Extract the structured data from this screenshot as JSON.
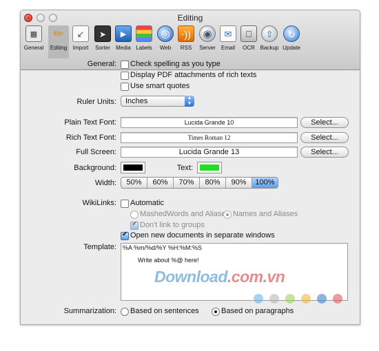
{
  "window": {
    "title": "Editing"
  },
  "toolbar": [
    {
      "label": "General"
    },
    {
      "label": "Editing"
    },
    {
      "label": "Import"
    },
    {
      "label": "Sorter"
    },
    {
      "label": "Media"
    },
    {
      "label": "Labels"
    },
    {
      "label": "Web"
    },
    {
      "label": "RSS"
    },
    {
      "label": "Server"
    },
    {
      "label": "Email"
    },
    {
      "label": "OCR"
    },
    {
      "label": "Backup"
    },
    {
      "label": "Update"
    }
  ],
  "general": {
    "label": "General:",
    "options": [
      {
        "label": "Check spelling as you type",
        "checked": false
      },
      {
        "label": "Display PDF attachments of rich texts",
        "checked": false
      },
      {
        "label": "Use smart quotes",
        "checked": false
      }
    ]
  },
  "ruler": {
    "label": "Ruler Units:",
    "value": "Inches"
  },
  "fonts": {
    "plain": {
      "label": "Plain Text Font:",
      "value": "Lucida Grande 10"
    },
    "rich": {
      "label": "Rich Text Font:",
      "value": "Times Roman 12"
    },
    "full": {
      "label": "Full Screen:",
      "value": "Lucida Grande 13"
    },
    "select_label": "Select..."
  },
  "colors": {
    "background_label": "Background:",
    "background_color": "#000000",
    "text_label": "Text:",
    "text_color": "#1fe01f"
  },
  "width": {
    "label": "Width:",
    "options": [
      "50%",
      "60%",
      "70%",
      "80%",
      "90%",
      "100%"
    ],
    "selected": "100%"
  },
  "wikilinks": {
    "label": "WikiLinks:",
    "automatic": "Automatic",
    "mashed": "MashedWords and Aliases",
    "names": "Names and Aliases",
    "dont_link": "Don't link to groups"
  },
  "open_new": "Open new documents in separate windows",
  "template": {
    "label": "Template:",
    "line1": "%A %m/%d/%Y %H:%M:%S",
    "line2": "Write about %@ here!"
  },
  "summarization": {
    "label": "Summarization:",
    "sentences": "Based on sentences",
    "paragraphs": "Based on paragraphs",
    "selected": "paragraphs"
  },
  "watermark": {
    "main": "Download",
    "domain": ".com.vn"
  }
}
